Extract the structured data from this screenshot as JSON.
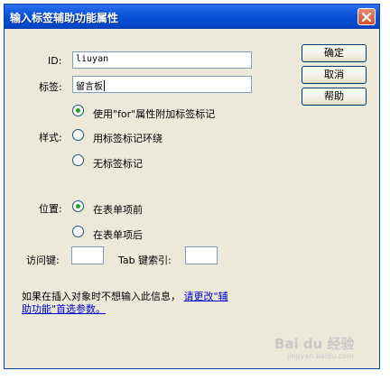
{
  "window": {
    "title": "输入标签辅助功能属性"
  },
  "form": {
    "id_label": "ID:",
    "id_value": "liuyan",
    "tag_label": "标签:",
    "tag_value": "留言板",
    "style_label": "样式:",
    "style_options": [
      {
        "label": "使用\"for\"属性附加标签标记",
        "checked": true
      },
      {
        "label": "用标签标记环绕",
        "checked": false
      },
      {
        "label": "无标签标记",
        "checked": false
      }
    ],
    "position_label": "位置:",
    "position_options": [
      {
        "label": "在表单项前",
        "checked": true
      },
      {
        "label": "在表单项后",
        "checked": false
      }
    ],
    "access_key_label": "访问键:",
    "access_key_value": "",
    "tab_index_label": "Tab 键索引:",
    "tab_index_value": ""
  },
  "buttons": {
    "ok": "确定",
    "cancel": "取消",
    "help": "帮助"
  },
  "footer": {
    "text": "如果在插入对象时不想输入此信息，",
    "link_line1": "请更改\"辅",
    "link_line2": "助功能\"首选参数。"
  },
  "watermark": {
    "text": "Bai du 经验",
    "sub": "jingyan.baidu.com"
  },
  "colors": {
    "titlebar": "#0a53d8",
    "dialog_bg": "#ece9d8",
    "radio_dot": "#21a121",
    "link": "#0000cc"
  },
  "icons": {
    "close": "close-icon"
  }
}
